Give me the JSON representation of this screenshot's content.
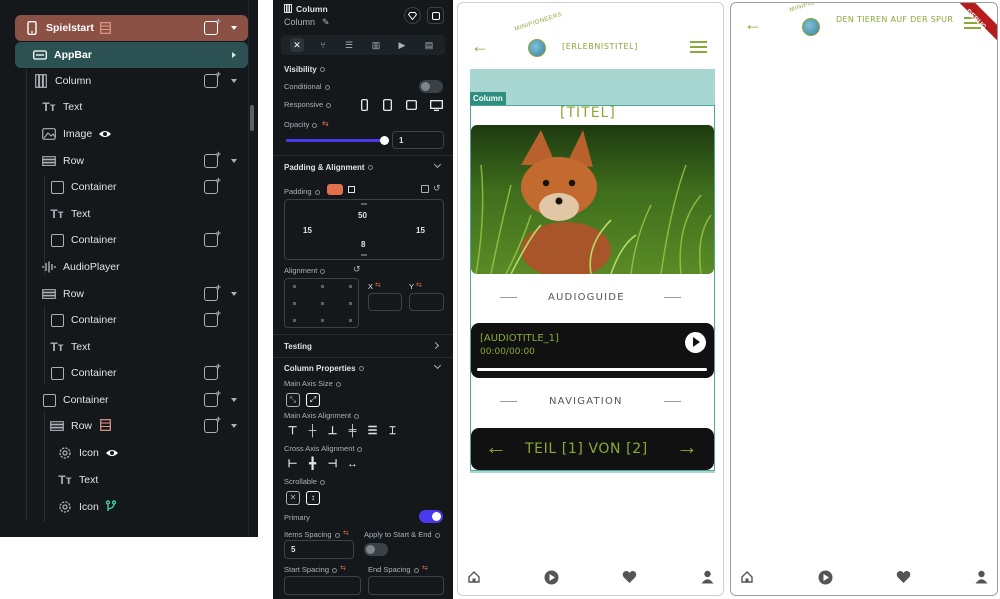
{
  "tree": {
    "items": [
      {
        "label": "Spielstart",
        "icon": "phone-icon"
      },
      {
        "label": "AppBar",
        "icon": "appbar-icon"
      },
      {
        "label": "Column",
        "icon": "column-icon"
      },
      {
        "label": "Text",
        "icon": "text-icon"
      },
      {
        "label": "Image",
        "icon": "image-icon"
      },
      {
        "label": "Row",
        "icon": "row-icon"
      },
      {
        "label": "Container",
        "icon": "container-icon"
      },
      {
        "label": "Text",
        "icon": "text-icon"
      },
      {
        "label": "Container",
        "icon": "container-icon"
      },
      {
        "label": "AudioPlayer",
        "icon": "audio-icon"
      },
      {
        "label": "Row",
        "icon": "row-icon"
      },
      {
        "label": "Container",
        "icon": "container-icon"
      },
      {
        "label": "Text",
        "icon": "text-icon"
      },
      {
        "label": "Container",
        "icon": "container-icon"
      },
      {
        "label": "Container",
        "icon": "container-icon"
      },
      {
        "label": "Row",
        "icon": "row-icon"
      },
      {
        "label": "Icon",
        "icon": "gear-icon"
      },
      {
        "label": "Text",
        "icon": "text-icon"
      },
      {
        "label": "Icon",
        "icon": "gear-icon"
      }
    ]
  },
  "props": {
    "widget_type": "Column",
    "widget_name": "Column",
    "visibility": {
      "title": "Visibility",
      "conditional_label": "Conditional",
      "responsive_label": "Responsive",
      "opacity_label": "Opacity",
      "opacity_value": "1",
      "opacity_fraction": 1.0
    },
    "padding": {
      "title": "Padding & Alignment",
      "padding_label": "Padding",
      "top": "50",
      "left": "15",
      "right": "15",
      "bottom": "8",
      "alignment_label": "Alignment",
      "x_label": "X",
      "y_label": "Y"
    },
    "testing_title": "Testing",
    "column_props": {
      "title": "Column Properties",
      "main_axis_size_label": "Main Axis Size",
      "main_axis_alignment_label": "Main Axis Alignment",
      "cross_axis_alignment_label": "Cross Axis Alignment",
      "scrollable_label": "Scrollable",
      "primary_label": "Primary",
      "items_spacing_label": "Items Spacing",
      "items_spacing_value": "5",
      "apply_start_end_label": "Apply to Start & End",
      "start_spacing_label": "Start Spacing",
      "end_spacing_label": "End Spacing"
    }
  },
  "phone1": {
    "appbar_title": "[ERLEBNISTITEL]",
    "logo_text": "MINIPIONEERS",
    "column_badge": "Column",
    "title": "[TITEL]",
    "audioguide_label": "AUDIOGUIDE",
    "audio_title": "[AUDIOTITLE_1]",
    "audio_time": "00:00/00:00",
    "navigation_label": "NAVIGATION",
    "pager_text": "TEIL [1] VON [2]"
  },
  "phone2": {
    "appbar_title": "DEN TIEREN AUF DER SPUR",
    "logo_text": "MINIPIONEERS",
    "debug_banner": "DEBUG"
  },
  "colors": {
    "olive": "#8aa93a",
    "teal_bg": "#a8d7d1",
    "teal_border": "#4fa69a",
    "dark": "#14181b",
    "selected_page": "#8c5145",
    "selected_appbar": "#2b5152",
    "primary_blue": "#4b39ef",
    "accent_orange": "#e0704e"
  }
}
